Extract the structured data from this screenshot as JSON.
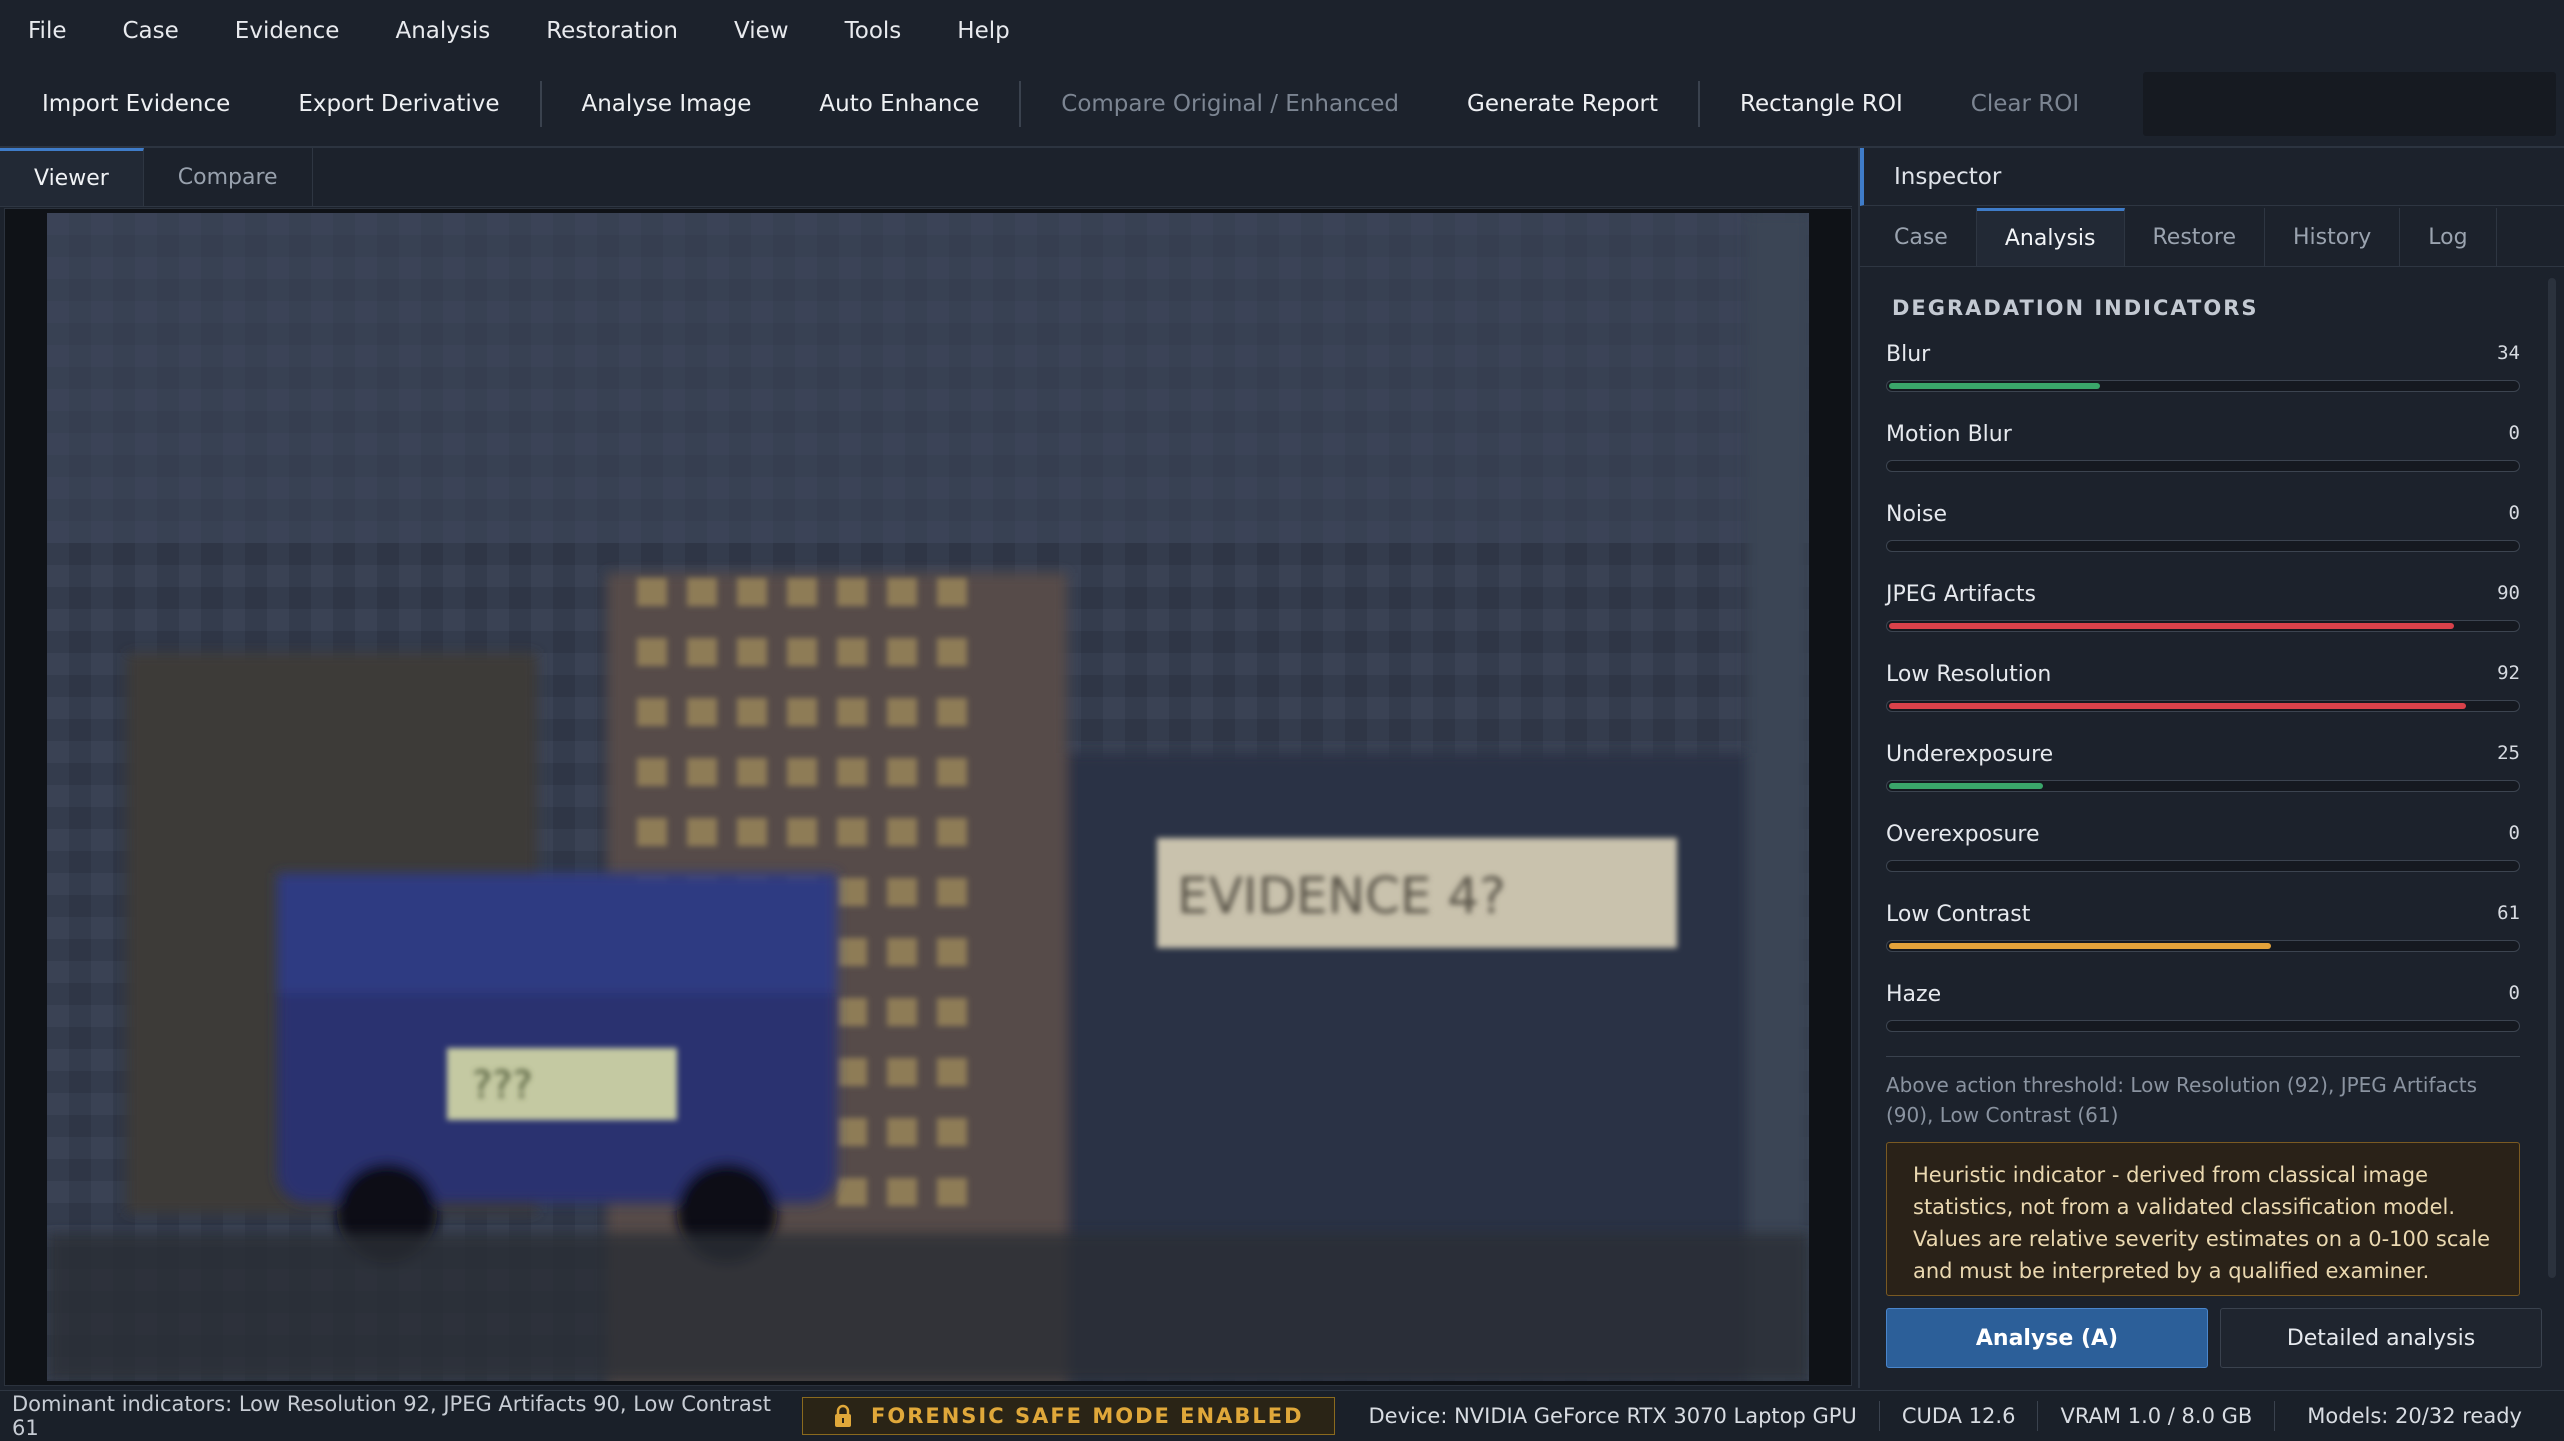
{
  "menu": [
    "File",
    "Case",
    "Evidence",
    "Analysis",
    "Restoration",
    "View",
    "Tools",
    "Help"
  ],
  "toolbar": {
    "import": "Import Evidence",
    "export": "Export Derivative",
    "analyse": "Analyse Image",
    "auto_enhance": "Auto Enhance",
    "compare": "Compare Original / Enhanced",
    "report": "Generate Report",
    "rect_roi": "Rectangle ROI",
    "clear_roi": "Clear ROI"
  },
  "viewer_tabs": [
    "Viewer",
    "Compare"
  ],
  "viewer_image": {
    "plate_large": "EVIDENCE 4?",
    "plate_small": "???"
  },
  "inspector": {
    "title": "Inspector",
    "tabs": [
      "Case",
      "Analysis",
      "Restore",
      "History",
      "Log"
    ],
    "section_title": "DEGRADATION INDICATORS",
    "indicators": [
      {
        "label": "Blur",
        "value": 34,
        "color": "#3aa56a"
      },
      {
        "label": "Motion Blur",
        "value": 0,
        "color": "#3aa56a"
      },
      {
        "label": "Noise",
        "value": 0,
        "color": "#3aa56a"
      },
      {
        "label": "JPEG Artifacts",
        "value": 90,
        "color": "#d9414a"
      },
      {
        "label": "Low Resolution",
        "value": 92,
        "color": "#d9414a"
      },
      {
        "label": "Underexposure",
        "value": 25,
        "color": "#3aa56a"
      },
      {
        "label": "Overexposure",
        "value": 0,
        "color": "#3aa56a"
      },
      {
        "label": "Low Contrast",
        "value": 61,
        "color": "#e3a23a"
      },
      {
        "label": "Haze",
        "value": 0,
        "color": "#3aa56a"
      }
    ],
    "threshold_text": "Above action threshold: Low Resolution (92), JPEG Artifacts (90), Low Contrast (61)",
    "note": "Heuristic indicator - derived from classical image statistics, not from a validated classification model. Values are relative severity estimates on a 0-100 scale and must be interpreted by a qualified examiner.",
    "analyse_button": "Analyse  (A)",
    "detailed_button": "Detailed analysis"
  },
  "status": {
    "dominant": "Dominant indicators: Low Resolution 92, JPEG Artifacts 90, Low Contrast 61",
    "safe_mode": "FORENSIC SAFE MODE ENABLED",
    "device": "Device: NVIDIA GeForce RTX 3070 Laptop GPU",
    "cuda": "CUDA 12.6",
    "vram": "VRAM 1.0 / 8.0 GB",
    "models": "Models: 20/32 ready"
  }
}
